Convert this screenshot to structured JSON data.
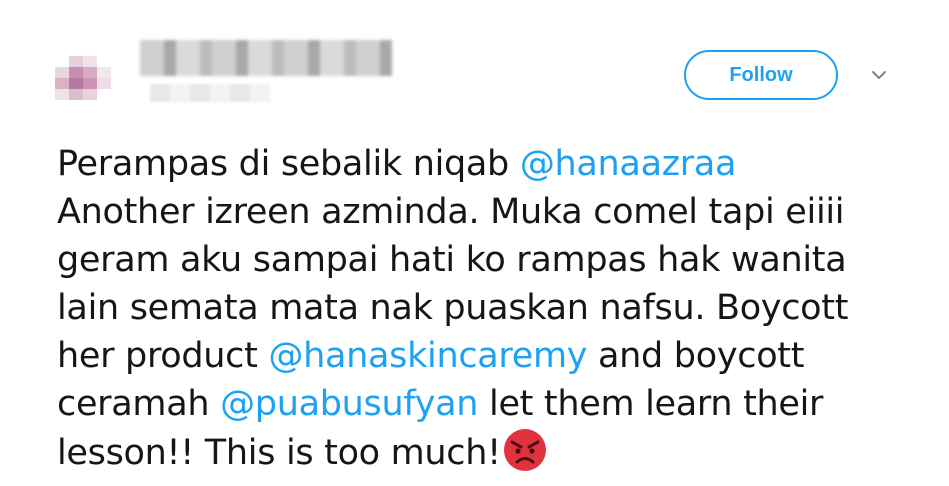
{
  "header": {
    "follow_label": "Follow",
    "menu_icon": "chevron-down-icon"
  },
  "tweet": {
    "lines": [
      [
        {
          "text": "Perampas di sebalik niqab ",
          "type": "text"
        },
        {
          "text": "@hanaazraa",
          "type": "mention"
        }
      ],
      [
        {
          "text": "Another izreen azminda. Muka comel tapi eiiii",
          "type": "text"
        }
      ],
      [
        {
          "text": "geram aku sampai hati ko rampas hak wanita",
          "type": "text"
        }
      ],
      [
        {
          "text": "lain semata mata nak puaskan nafsu. Boycott",
          "type": "text"
        }
      ],
      [
        {
          "text": "her product ",
          "type": "text"
        },
        {
          "text": "@hanaskincaremy",
          "type": "mention"
        },
        {
          "text": " and boycott",
          "type": "text"
        }
      ],
      [
        {
          "text": "ceramah ",
          "type": "text"
        },
        {
          "text": "@puabusufyan",
          "type": "mention"
        },
        {
          "text": " let them learn their",
          "type": "text"
        }
      ],
      [
        {
          "text": "lesson!! This is too much!",
          "type": "text"
        }
      ]
    ],
    "emoji": "angry-face-icon"
  },
  "colors": {
    "accent": "#1DA1F2",
    "text": "#14171a",
    "emoji_red": "#E0333E"
  }
}
